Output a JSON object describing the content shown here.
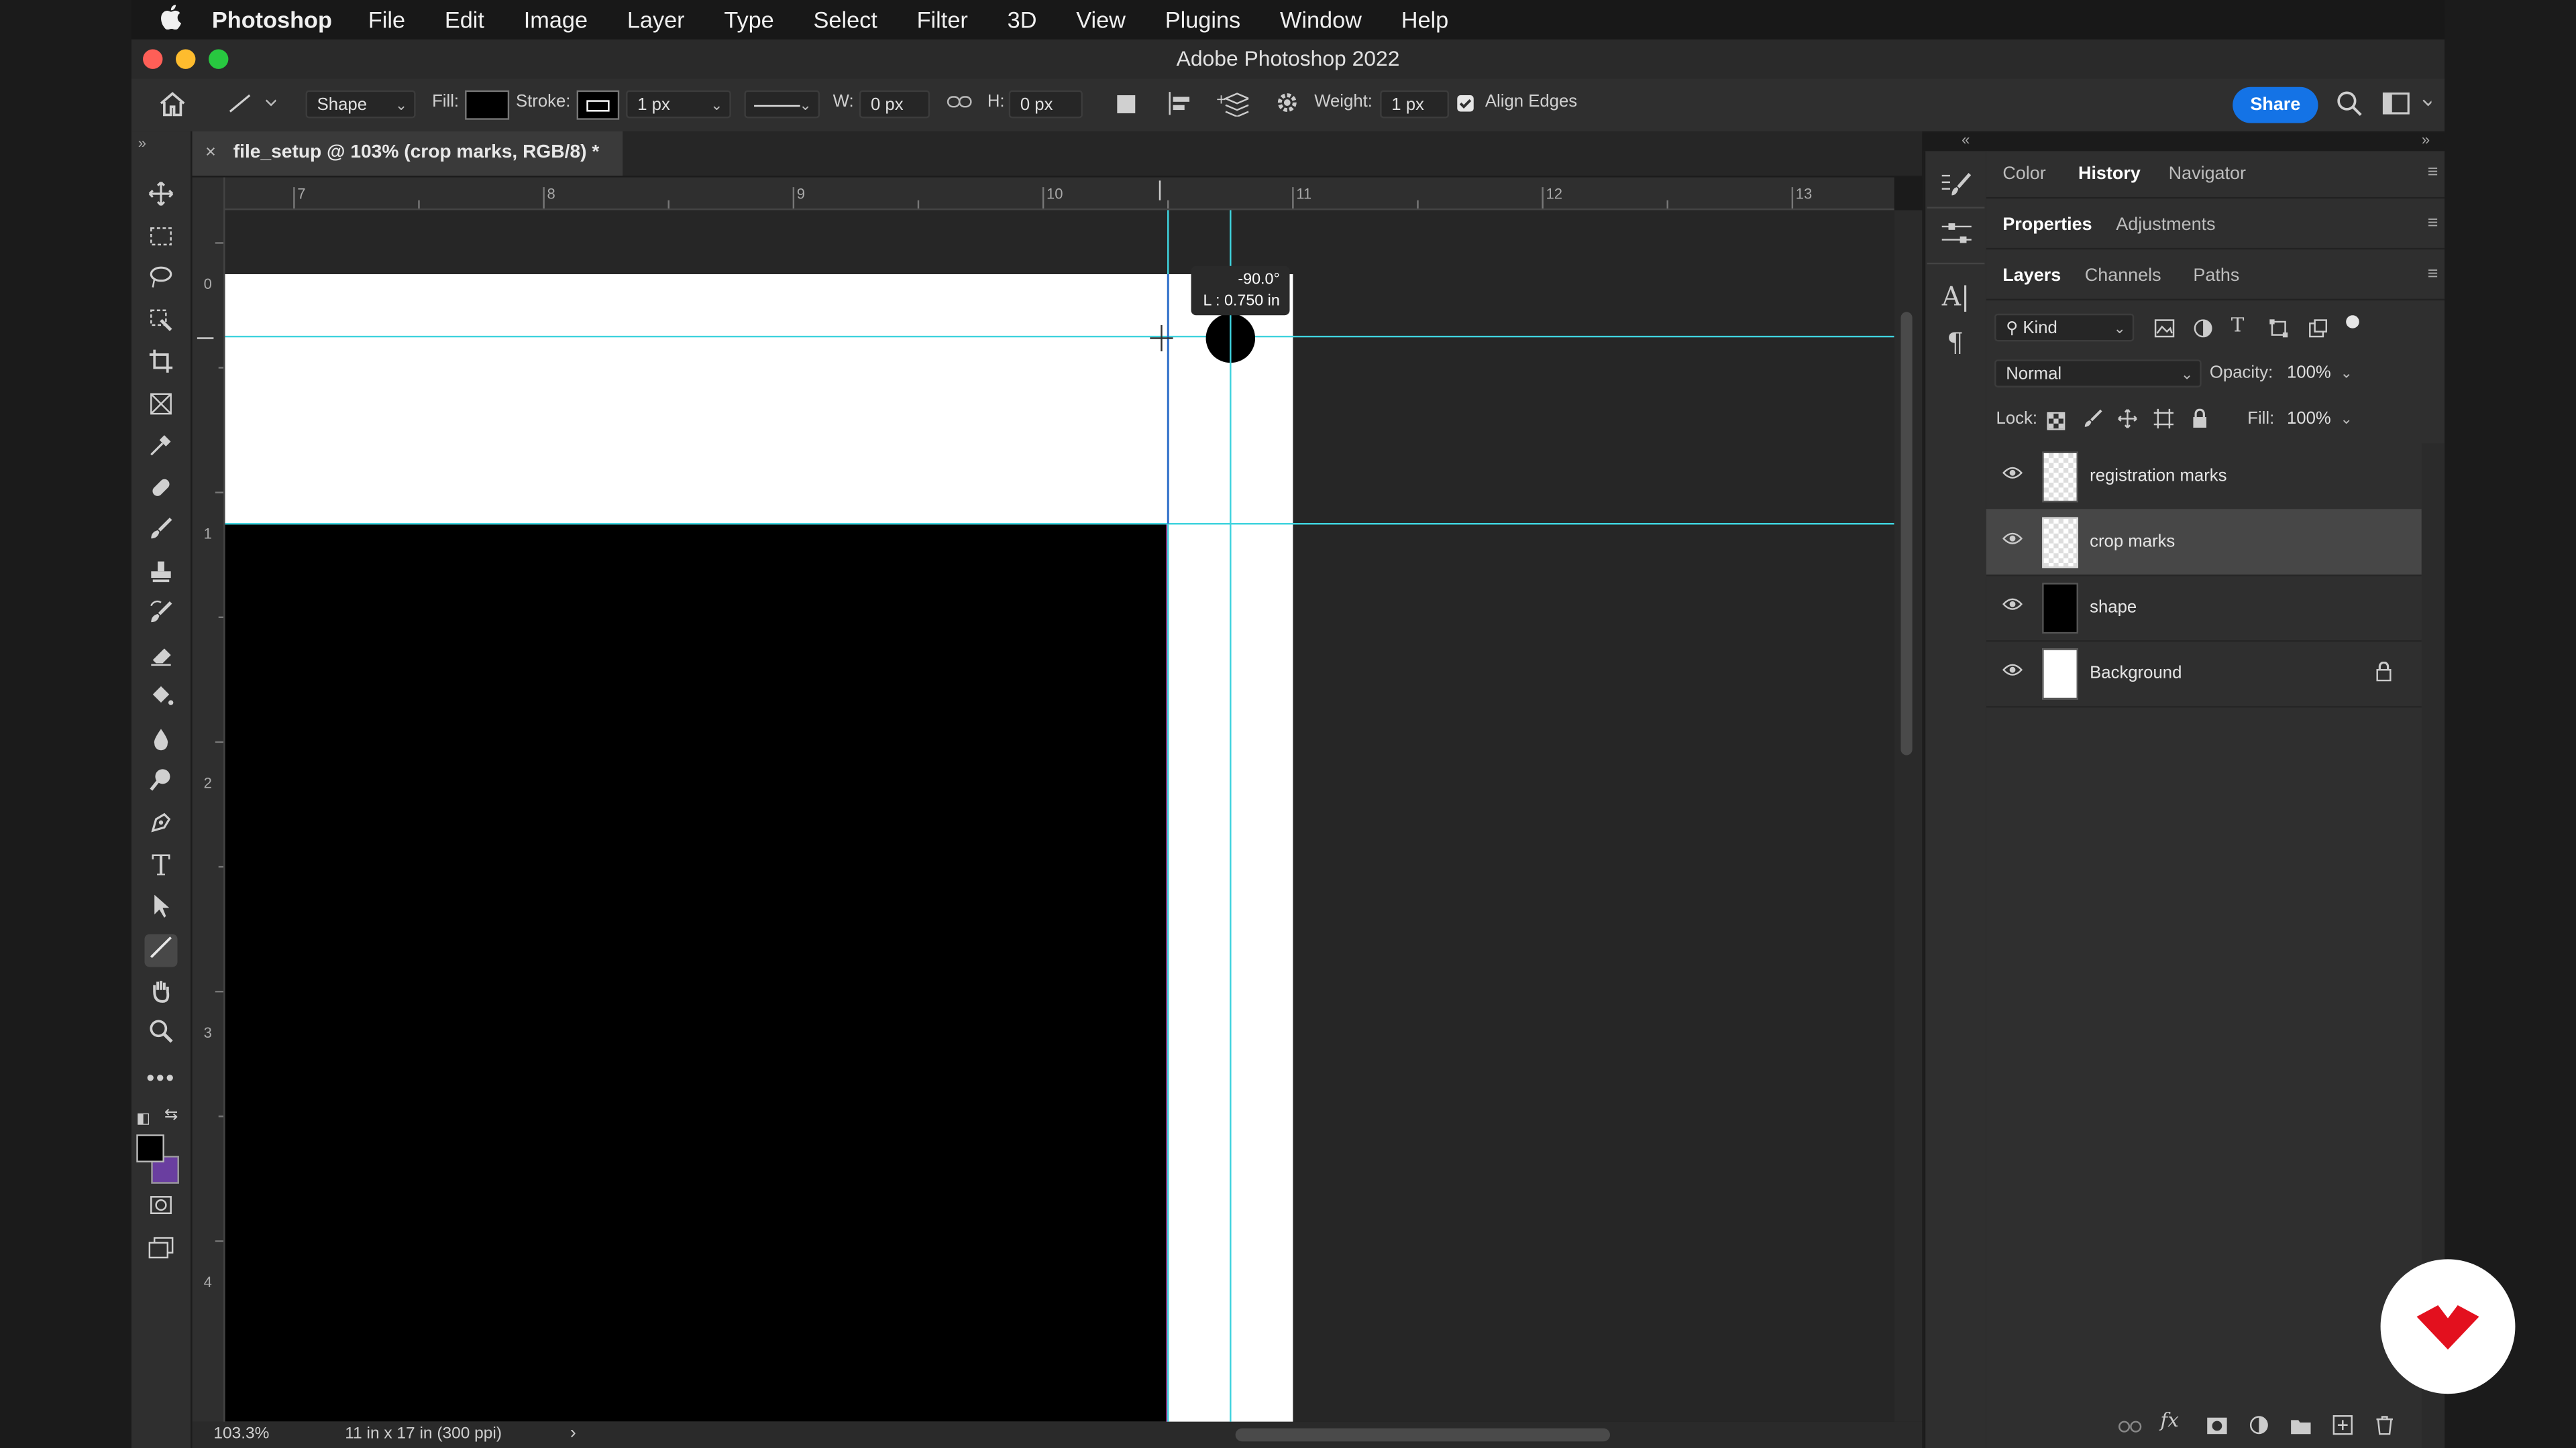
{
  "menubar": {
    "apple": "",
    "app": "Photoshop",
    "items": [
      "File",
      "Edit",
      "Image",
      "Layer",
      "Type",
      "Select",
      "Filter",
      "3D",
      "View",
      "Plugins",
      "Window",
      "Help"
    ]
  },
  "window": {
    "title": "Adobe Photoshop 2022"
  },
  "options": {
    "shape_mode": "Shape",
    "fill_label": "Fill:",
    "stroke_label": "Stroke:",
    "stroke_width": "1 px",
    "w_label": "W:",
    "w_value": "0 px",
    "h_label": "H:",
    "h_value": "0 px",
    "weight_label": "Weight:",
    "weight_value": "1 px",
    "align_edges": "Align Edges",
    "share": "Share"
  },
  "document": {
    "tab_title": "file_setup @ 103% (crop marks, RGB/8) *",
    "close": "×",
    "ruler_top": [
      "7",
      "8",
      "9",
      "10",
      "11",
      "12",
      "13"
    ],
    "ruler_left": [
      "0",
      "1",
      "2",
      "3",
      "4"
    ],
    "tooltip_angle": "-90.0°",
    "tooltip_length": "L : 0.750 in",
    "zoom": "103.3%",
    "doc_info": "11 in x 17 in (300 ppi)",
    "status_arrow": "›"
  },
  "panels": {
    "group1_tabs": [
      "Color",
      "History",
      "Navigator"
    ],
    "group1_active": "History",
    "group2_tabs": [
      "Properties",
      "Adjustments"
    ],
    "group2_active": "Properties",
    "group3_tabs": [
      "Layers",
      "Channels",
      "Paths"
    ],
    "group3_active": "Layers",
    "filter_kind": "Kind",
    "blend_mode": "Normal",
    "opacity_label": "Opacity:",
    "opacity_value": "100%",
    "lock_label": "Lock:",
    "fill_label": "Fill:",
    "fill_value": "100%",
    "layers": [
      {
        "name": "registration marks",
        "thumb": "transparent",
        "selected": false,
        "locked": false
      },
      {
        "name": "crop marks",
        "thumb": "transparent",
        "selected": true,
        "locked": false
      },
      {
        "name": "shape",
        "thumb": "black",
        "selected": false,
        "locked": false
      },
      {
        "name": "Background",
        "thumb": "white",
        "selected": false,
        "locked": true
      }
    ]
  },
  "colors": {
    "guide": "#3fd3de",
    "accent": "#1473e6",
    "logo": "#e3101e",
    "foreground": "#000000",
    "background_swatch": "#6a3ea0"
  },
  "icons": [
    "apple-icon",
    "home-icon",
    "line-tool-icon",
    "link-icon",
    "gear-icon",
    "search-icon",
    "workspace-icon",
    "eye-icon",
    "lock-icon"
  ]
}
